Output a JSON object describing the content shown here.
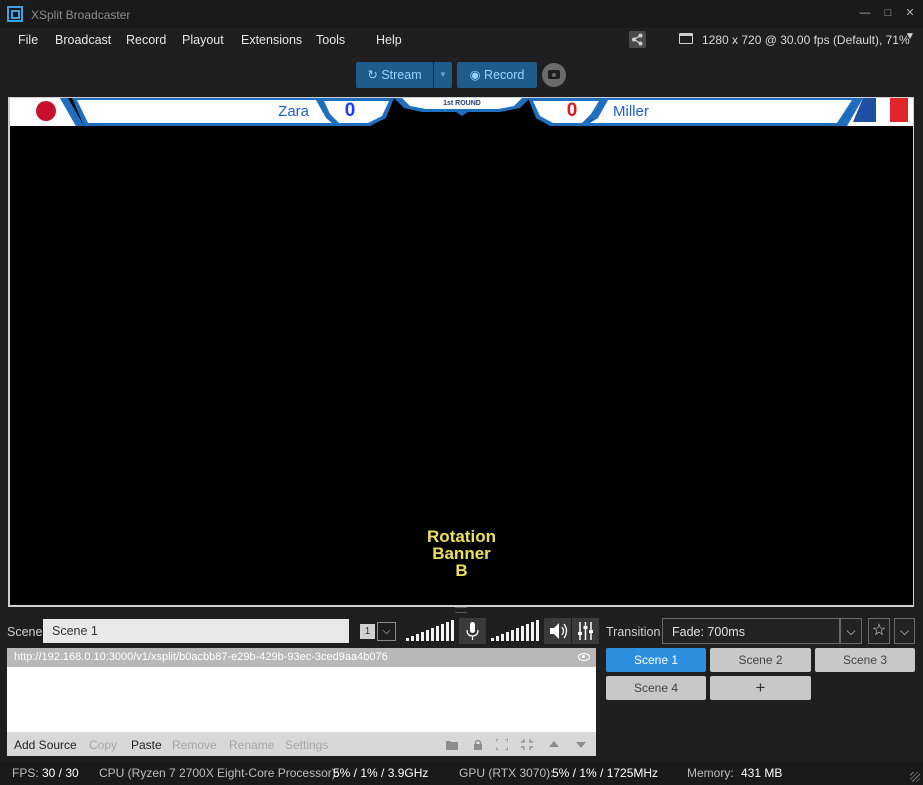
{
  "window": {
    "title": "XSplit Broadcaster",
    "controls": {
      "minimize": "—",
      "maximize": "□",
      "close": "✕"
    }
  },
  "menu": {
    "items": [
      "File",
      "Broadcast",
      "Record",
      "Playout",
      "Extensions",
      "Tools",
      "Help"
    ]
  },
  "header": {
    "resolution": "1280 x 720 @ 30.00 fps (Default), 71%",
    "resolution_caret": "▼"
  },
  "toolbar": {
    "stream_label": "Stream",
    "stream_icon": "↻",
    "stream_drop": "▼",
    "record_label": "Record",
    "record_icon": "◉"
  },
  "overlay": {
    "left_player": "Zara",
    "left_score": "0",
    "right_player": "Miller",
    "right_score": "0",
    "round": "1st ROUND",
    "banner_lines": [
      "Rotation",
      "Banner",
      "B"
    ]
  },
  "scene_panel": {
    "label": "Scene",
    "name": "Scene 1",
    "number": "1",
    "number_caret": "⌵"
  },
  "sources": {
    "items": [
      {
        "url": "http://192.168.0.10:3000/v1/xsplit/b0acbb87-e29b-429b-93ec-3ced9aa4b076"
      }
    ],
    "buttons": [
      "Add Source",
      "Copy",
      "Paste",
      "Remove",
      "Rename",
      "Settings"
    ]
  },
  "transition": {
    "label": "Transition",
    "value": "Fade: 700ms",
    "caret": "⌵",
    "star": "☆",
    "more": "⌵"
  },
  "scenes": {
    "buttons": [
      "Scene 1",
      "Scene 2",
      "Scene 3",
      "Scene 4"
    ],
    "add": "+"
  },
  "status": {
    "fps_label": "FPS:",
    "fps_value": "30 / 30",
    "cpu_label": "CPU (Ryzen 7 2700X Eight-Core Processor):",
    "cpu_value": "5% / 1% / 3.9GHz",
    "gpu_label": "GPU (RTX 3070):",
    "gpu_value": "5% / 1% / 1725MHz",
    "mem_label": "Memory:",
    "mem_value": "431 MB"
  },
  "colors": {
    "accent": "#2d8fe0",
    "stream_button": "#1f5c8c",
    "left_score": "#1a3cff",
    "right_score": "#e01b1b",
    "banner_text": "#ebe05a",
    "overlay_frame": "#1e6fc0"
  }
}
